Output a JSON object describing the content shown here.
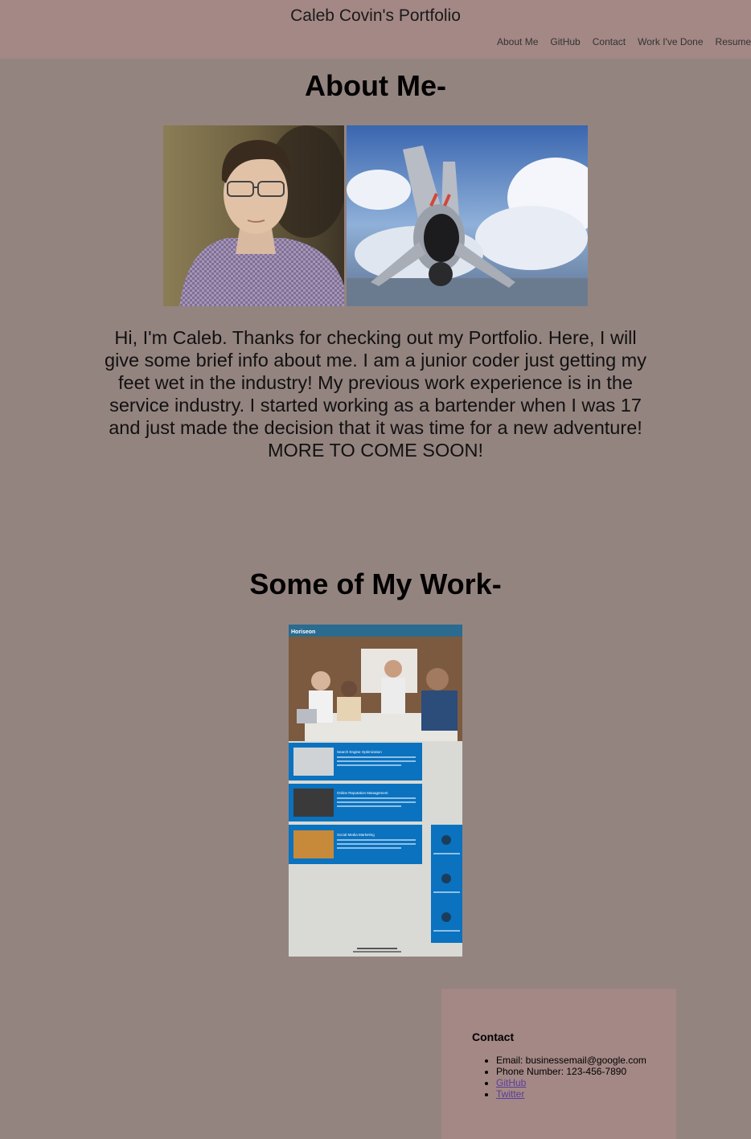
{
  "header": {
    "title": "Caleb Covin's Portfolio",
    "nav": [
      "About Me",
      "GitHub",
      "Contact",
      "Work I've Done",
      "Resume"
    ]
  },
  "about": {
    "heading": "About Me-",
    "bio": "Hi, I'm Caleb. Thanks for checking out my Portfolio. Here, I will give some brief info about me. I am a junior coder just getting my feet wet in the industry! My previous work experience is in the service industry. I started working as a bartender when I was 17 and just made the decision that it was time for a new adventure! MORE TO COME SOON!"
  },
  "work": {
    "heading": "Some of My Work-",
    "screenshot": {
      "brand": "Horiseon",
      "sections": [
        "Search Engine Optimization",
        "Online Reputation Management",
        "Social Media Marketing"
      ]
    }
  },
  "contact": {
    "heading": "Contact",
    "email": "Email: businessemail@google.com",
    "phone": "Phone Number: 123-456-7890",
    "github": "GitHub",
    "twitter": "Twitter"
  },
  "colors": {
    "background": "#94847f",
    "header": "#a38885",
    "link": "#5b3d9c",
    "horiseon_blue": "#0a72bf"
  }
}
